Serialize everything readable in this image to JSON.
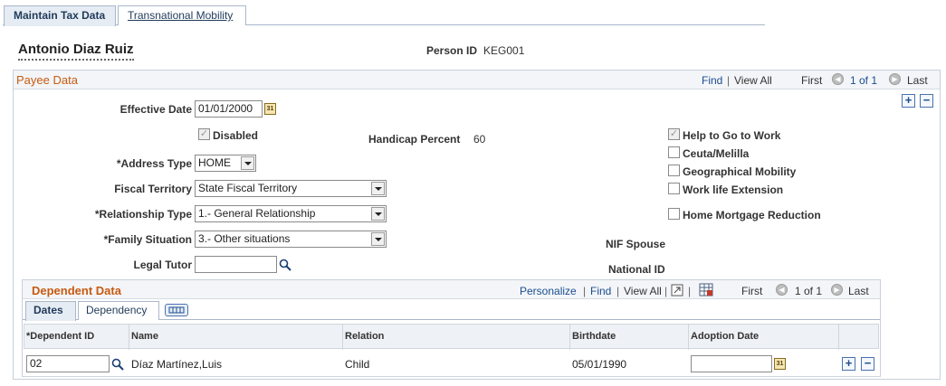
{
  "tabs": [
    {
      "label": "Maintain Tax Data",
      "active": true
    },
    {
      "label": "Transnational Mobility",
      "active": false
    }
  ],
  "person": {
    "name": "Antonio Diaz Ruiz",
    "id_label": "Person ID",
    "id_value": "KEG001"
  },
  "payee": {
    "title": "Payee Data",
    "nav": {
      "find": "Find",
      "sep": "|",
      "view_all": "View All",
      "first": "First",
      "count": "1 of 1",
      "last": "Last"
    },
    "effective_date_label": "Effective Date",
    "effective_date_value": "01/01/2000",
    "disabled_label": "Disabled",
    "handicap_label": "Handicap Percent",
    "handicap_value": "60",
    "address_type_label": "*Address Type",
    "address_type_value": "HOME",
    "fiscal_territory_label": "Fiscal Territory",
    "fiscal_territory_value": "State Fiscal Territory",
    "relationship_type_label": "*Relationship Type",
    "relationship_type_value": "1.- General Relationship",
    "family_situation_label": "*Family Situation",
    "family_situation_value": "3.- Other situations",
    "legal_tutor_label": "Legal Tutor",
    "legal_tutor_value": "",
    "nif_spouse_label": "NIF Spouse",
    "national_id_label": "National ID",
    "checkboxes": [
      {
        "label": "Help to Go to Work",
        "checked": true,
        "disabled": true
      },
      {
        "label": "Ceuta/Melilla",
        "checked": false,
        "disabled": false
      },
      {
        "label": "Geographical Mobility",
        "checked": false,
        "disabled": false
      },
      {
        "label": "Work life Extension",
        "checked": false,
        "disabled": false
      },
      {
        "label": "Home Mortgage Reduction",
        "checked": false,
        "disabled": false
      }
    ]
  },
  "dependent": {
    "title": "Dependent Data",
    "nav": {
      "personalize": "Personalize",
      "find": "Find",
      "view_all": "View All",
      "sep": "|",
      "first": "First",
      "count": "1 of 1",
      "last": "Last"
    },
    "subtabs": [
      {
        "label": "Dates",
        "active": true
      },
      {
        "label": "Dependency",
        "active": false
      }
    ],
    "columns": [
      "*Dependent ID",
      "Name",
      "Relation",
      "Birthdate",
      "Adoption Date"
    ],
    "rows": [
      {
        "dependent_id": "02",
        "name": "Díaz Martínez,Luis",
        "relation": "Child",
        "birthdate": "05/01/1990",
        "adoption_date": ""
      }
    ]
  },
  "icons": {
    "calendar": "calendar-icon",
    "lookup": "magnifier-icon",
    "add": "plus-icon",
    "delete": "minus-icon",
    "prev": "previous-arrow-icon",
    "next": "next-arrow-icon"
  },
  "colors": {
    "section_title": "#c85a10",
    "link": "#1a4d8f",
    "tab_active_bg": "#e6ecf3"
  }
}
